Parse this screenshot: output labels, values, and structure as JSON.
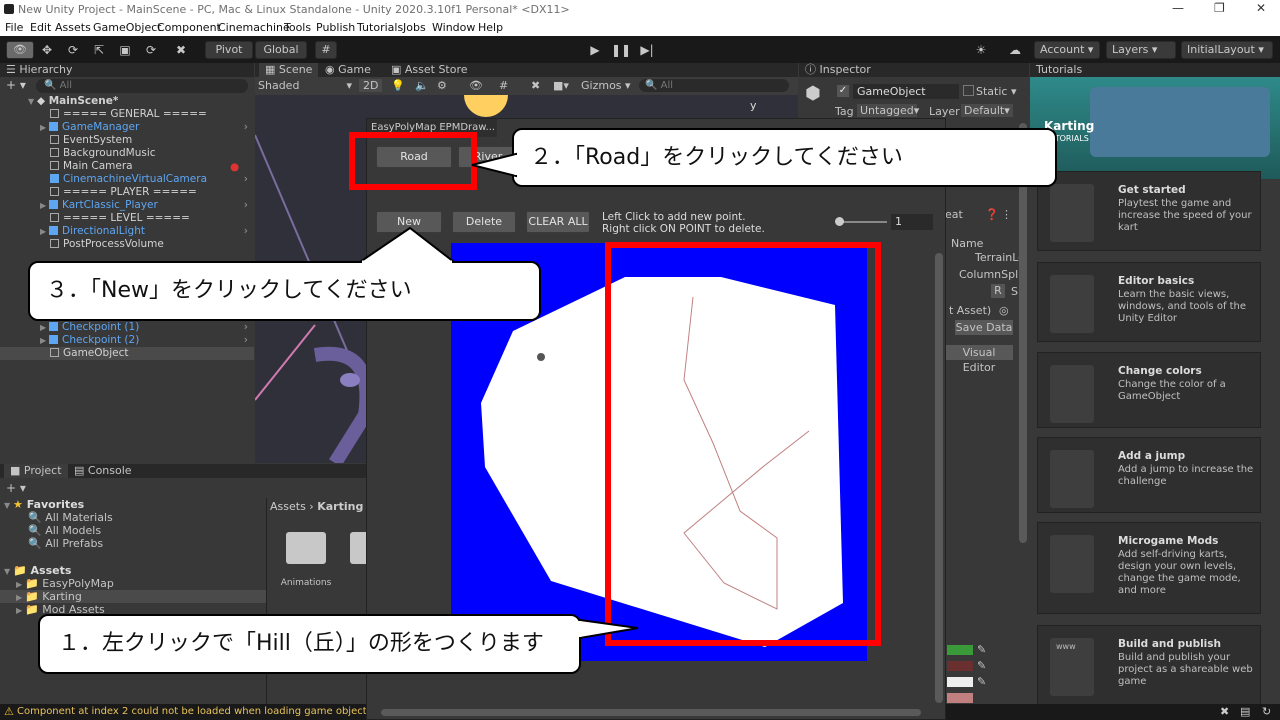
{
  "window": {
    "title": "New Unity Project - MainScene - PC, Mac & Linux Standalone - Unity 2020.3.10f1 Personal* <DX11>"
  },
  "menu": [
    "File",
    "Edit",
    "Assets",
    "GameObject",
    "Component",
    "Cinemachine",
    "Tools",
    "Publish",
    "Tutorials",
    "Jobs",
    "Window",
    "Help"
  ],
  "toolbar": {
    "pivot": "Pivot",
    "global": "Global",
    "account": "Account",
    "layers": "Layers",
    "layout": "InitialLayout"
  },
  "hierarchy": {
    "tab": "Hierarchy",
    "search_placeholder": "All",
    "items": [
      {
        "label": "MainScene*"
      },
      {
        "label": "===== GENERAL ====="
      },
      {
        "label": "GameManager"
      },
      {
        "label": "EventSystem"
      },
      {
        "label": "BackgroundMusic"
      },
      {
        "label": "Main Camera"
      },
      {
        "label": "CinemachineVirtualCamera"
      },
      {
        "label": "===== PLAYER ====="
      },
      {
        "label": "KartClassic_Player"
      },
      {
        "label": "===== LEVEL ====="
      },
      {
        "label": "DirectionalLight"
      },
      {
        "label": "PostProcessVolume"
      },
      {
        "label": "Checkpoint (1)"
      },
      {
        "label": "Checkpoint (2)"
      },
      {
        "label": "GameObject"
      }
    ]
  },
  "scene": {
    "tabs": [
      "Scene",
      "Game",
      "Asset Store"
    ],
    "shading": "Shaded",
    "mode2d": "2D",
    "gizmos": "Gizmos",
    "search_placeholder": "All",
    "axis_y": "y"
  },
  "inspector": {
    "tab": "Inspector",
    "object_name": "GameObject",
    "static": "Static",
    "tag_label": "Tag",
    "tag_value": "Untagged",
    "layer_label": "Layer",
    "layer_value": "Default",
    "name_label": "Name",
    "terrain": "TerrainLe",
    "column": "ColumnSplit",
    "r": "R",
    "s": "S",
    "asset": "t Asset)",
    "save_data": "Save Data",
    "visual_editor": "Visual Editor",
    "create_label": "eat"
  },
  "tutorials": {
    "tab": "Tutorials",
    "banner_title": "Karting",
    "banner_sub": "TUTORIALS",
    "cards": [
      {
        "title": "Get started",
        "desc": "Playtest the game and increase the speed of your kart"
      },
      {
        "title": "Editor basics",
        "desc": "Learn the basic views, windows, and tools of the Unity Editor"
      },
      {
        "title": "Change colors",
        "desc": "Change the color of a GameObject"
      },
      {
        "title": "Add a jump",
        "desc": "Add a jump to increase the challenge"
      },
      {
        "title": "Microgame Mods",
        "desc": "Add self-driving karts, design your own levels, change the game mode, and more"
      },
      {
        "title": "Build and publish",
        "desc": "Build and publish your project as a shareable web game"
      }
    ],
    "www": "www"
  },
  "project": {
    "tabs": [
      "Project",
      "Console"
    ],
    "favorites_label": "Favorites",
    "favorites": [
      "All Materials",
      "All Models",
      "All Prefabs"
    ],
    "assets_label": "Assets",
    "assets": [
      "EasyPolyMap",
      "Karting",
      "Mod Assets"
    ],
    "breadcrumb": [
      "Assets",
      "Karting"
    ],
    "folder": "Animations"
  },
  "epm": {
    "title": "EasyPolyMap EPMDraw...",
    "road": "Road",
    "river": "River",
    "new": "New",
    "delete": "Delete",
    "clear": "CLEAR ALL",
    "help1": "Left Click to add new point.",
    "help2": "Right click ON POINT to delete.",
    "slider_value": "1"
  },
  "callouts": {
    "c1": "１．左クリックで「Hill（丘）」の形をつくります",
    "c2": "２．「Road」をクリックしてください",
    "c3": "３．「New」をクリックしてください"
  },
  "status": {
    "message": "Component at index 2 could not be loaded when loading game object 'Ma"
  },
  "colors": {
    "accent_red": "#ff0000",
    "map_blue": "#0000ff",
    "unity_blue": "#5ea6f2"
  }
}
